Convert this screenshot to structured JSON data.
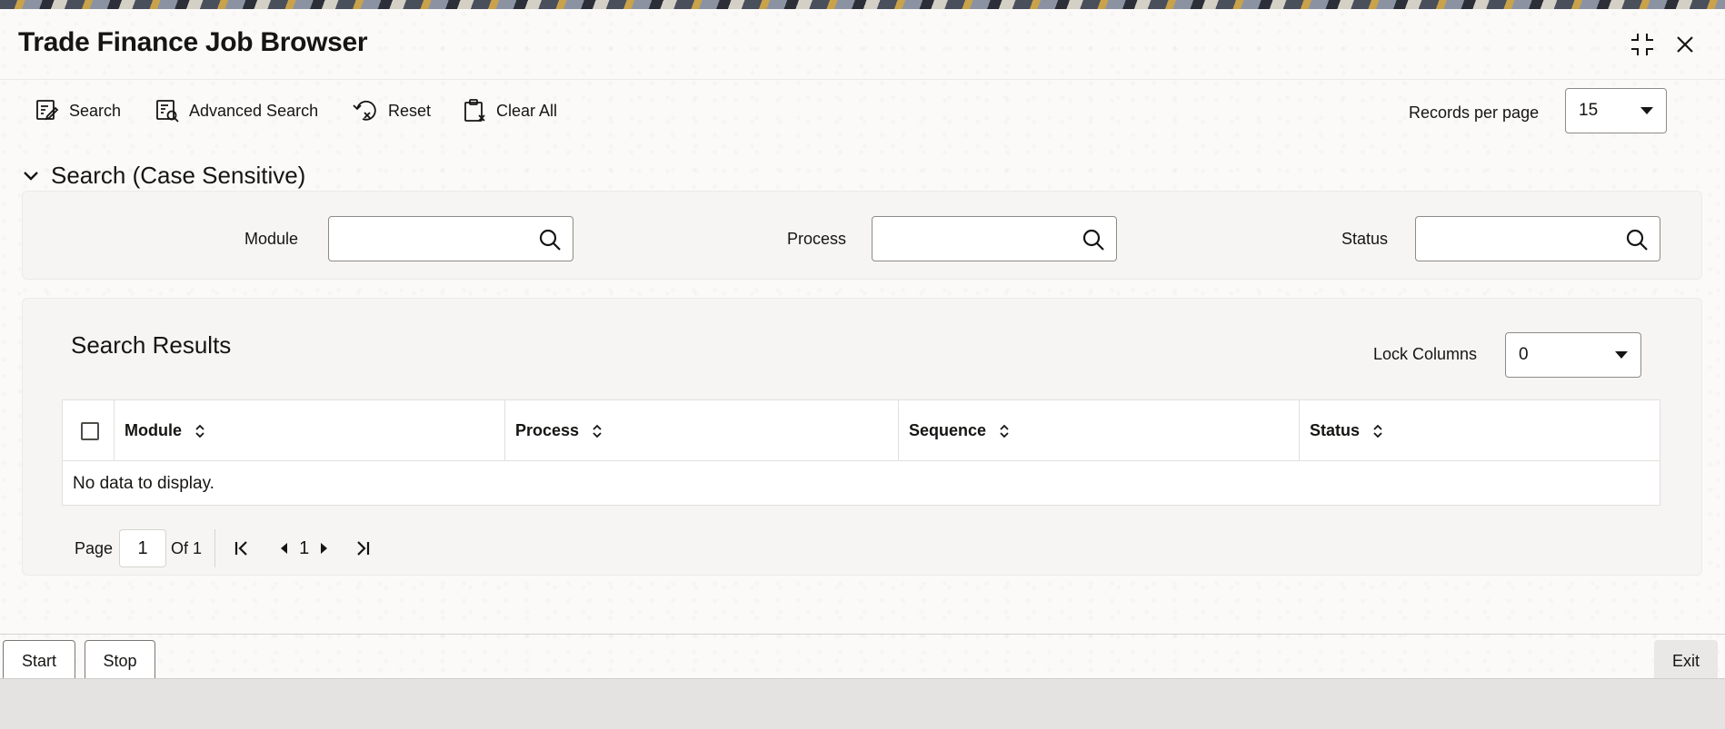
{
  "window": {
    "title": "Trade Finance Job Browser"
  },
  "window_controls": {
    "maximize_icon": "maximize-icon",
    "close_icon": "close-icon"
  },
  "toolbar": {
    "search_label": "Search",
    "advanced_search_label": "Advanced Search",
    "reset_label": "Reset",
    "clear_all_label": "Clear All"
  },
  "records_per_page": {
    "label": "Records per page",
    "value": "15"
  },
  "search_section": {
    "title": "Search (Case Sensitive)",
    "fields": {
      "module": {
        "label": "Module",
        "value": ""
      },
      "process": {
        "label": "Process",
        "value": ""
      },
      "status": {
        "label": "Status",
        "value": ""
      }
    }
  },
  "results": {
    "title": "Search Results",
    "lock_columns": {
      "label": "Lock Columns",
      "value": "0"
    },
    "columns": [
      "Module",
      "Process",
      "Sequence",
      "Status"
    ],
    "empty_message": "No data to display."
  },
  "pagination": {
    "page_label": "Page",
    "current_page": "1",
    "of_label": "Of 1",
    "page_number": "1"
  },
  "footer": {
    "start_label": "Start",
    "stop_label": "Stop",
    "exit_label": "Exit"
  },
  "colors": {
    "text": "#161513",
    "panel": "#f6f5f3",
    "border": "#8d8b88"
  }
}
